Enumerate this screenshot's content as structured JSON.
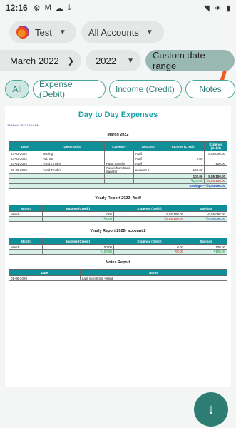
{
  "status": {
    "time": "12:16"
  },
  "top": {
    "account": "Test",
    "filter": "All Accounts"
  },
  "period": {
    "month": "March 2022",
    "year": "2022",
    "custom": "Custom date range"
  },
  "tabs": [
    "All",
    "Expense (Debit)",
    "Income (Credit)",
    "Notes"
  ],
  "report": {
    "title": "Day to Day Expenses",
    "timestamp": "23 March 2022,12:16 PM",
    "month_heading": "March 2022",
    "headers": [
      "Date",
      "Description",
      "Category",
      "Account",
      "Income (Credit)",
      "Expense (Debit)"
    ],
    "rows": [
      {
        "date": "23-03-2022",
        "desc": "Testing",
        "cat": "",
        "acct": "Asdf",
        "inc": "",
        "exp": "5,55,000.00"
      },
      {
        "date": "23-03-2022",
        "desc": "Adb Inc",
        "cat": "",
        "acct": "Asdf",
        "inc": "2.00",
        "exp": ""
      },
      {
        "date": "23-03-2022",
        "desc": "Fund Trnsfer",
        "cat": "Fund transfer",
        "acct": "Asdf",
        "inc": "",
        "exp": "100.00"
      },
      {
        "date": "23-03-2022",
        "desc": "Fund Trnsfer",
        "cat": "Funds from bank transfer",
        "acct": "account 2",
        "inc": "100.00",
        "exp": ""
      }
    ],
    "sum_income": "102.00",
    "sum_expense": "5,55,100.00",
    "sum_income_cur": "₹102.00",
    "sum_expense_cur": "₹5,55,100.00",
    "savings": "Savings = -₹5,54,998.00",
    "yearly1": {
      "title": "Yearly Report 2022- Asdf",
      "headers": [
        "Month",
        "Income (Credit)",
        "Expense (Debit)",
        "Savings"
      ],
      "row": {
        "m": "March",
        "inc": "2.00",
        "exp": "5,55,100.00",
        "sav": "-5,55,098.00"
      },
      "tot": {
        "inc": "₹2.00",
        "exp": "₹5,55,100.00",
        "sav": "-₹5,55,098.00"
      }
    },
    "yearly2": {
      "title": "Yearly Report 2022- account 2",
      "headers": [
        "Month",
        "Income (Credit)",
        "Expense (Debit)",
        "Savings"
      ],
      "row": {
        "m": "March",
        "inc": "100.00",
        "exp": "0.00",
        "sav": "100.00"
      },
      "tot": {
        "inc": "₹100.00",
        "exp": "₹0.00",
        "sav": "₹100.00"
      }
    },
    "notes": {
      "title": "Notes Report",
      "headers": [
        "Date",
        "Notes"
      ],
      "row": {
        "date": "01-08-2020",
        "note": "Last month bal +95kd"
      }
    }
  }
}
